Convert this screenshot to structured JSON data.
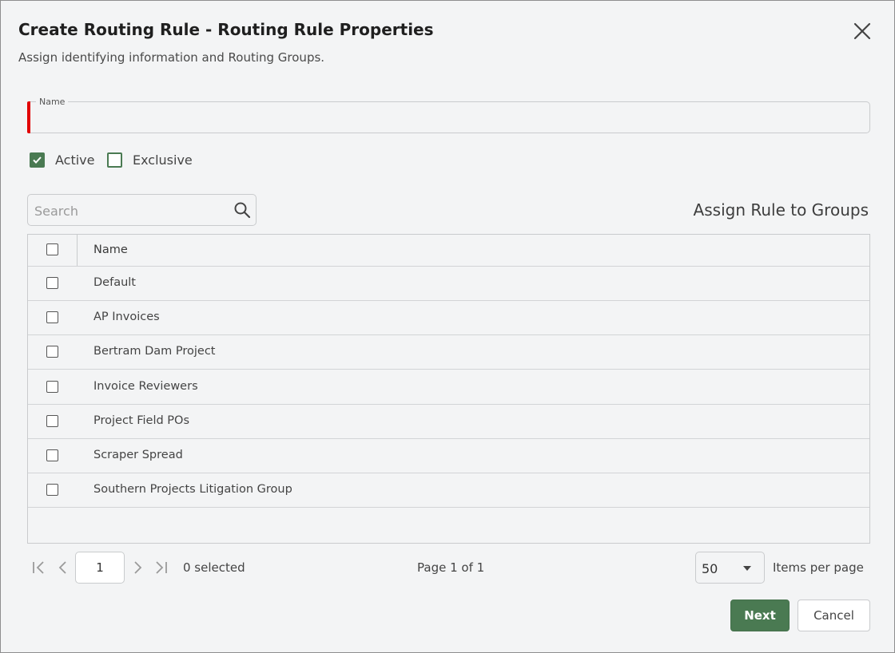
{
  "dialog": {
    "title": "Create Routing Rule - Routing Rule Properties",
    "subtitle": "Assign identifying information and Routing Groups."
  },
  "form": {
    "name_label": "Name",
    "name_value": "",
    "active_label": "Active",
    "active_checked": true,
    "exclusive_label": "Exclusive",
    "exclusive_checked": false
  },
  "search": {
    "placeholder": "Search"
  },
  "groups": {
    "section_title": "Assign Rule to Groups",
    "column_name": "Name",
    "rows": [
      "Default",
      "AP Invoices",
      "Bertram Dam Project",
      "Invoice Reviewers",
      "Project Field POs",
      "Scraper Spread",
      "Southern Projects Litigation Group"
    ]
  },
  "pager": {
    "page_value": "1",
    "selected_text": "0 selected",
    "page_text": "Page 1 of 1",
    "items_per_page_value": "50",
    "items_per_page_label": "Items per page"
  },
  "buttons": {
    "next": "Next",
    "cancel": "Cancel"
  },
  "colors": {
    "accent": "#4a7a52",
    "required": "#e10000"
  }
}
